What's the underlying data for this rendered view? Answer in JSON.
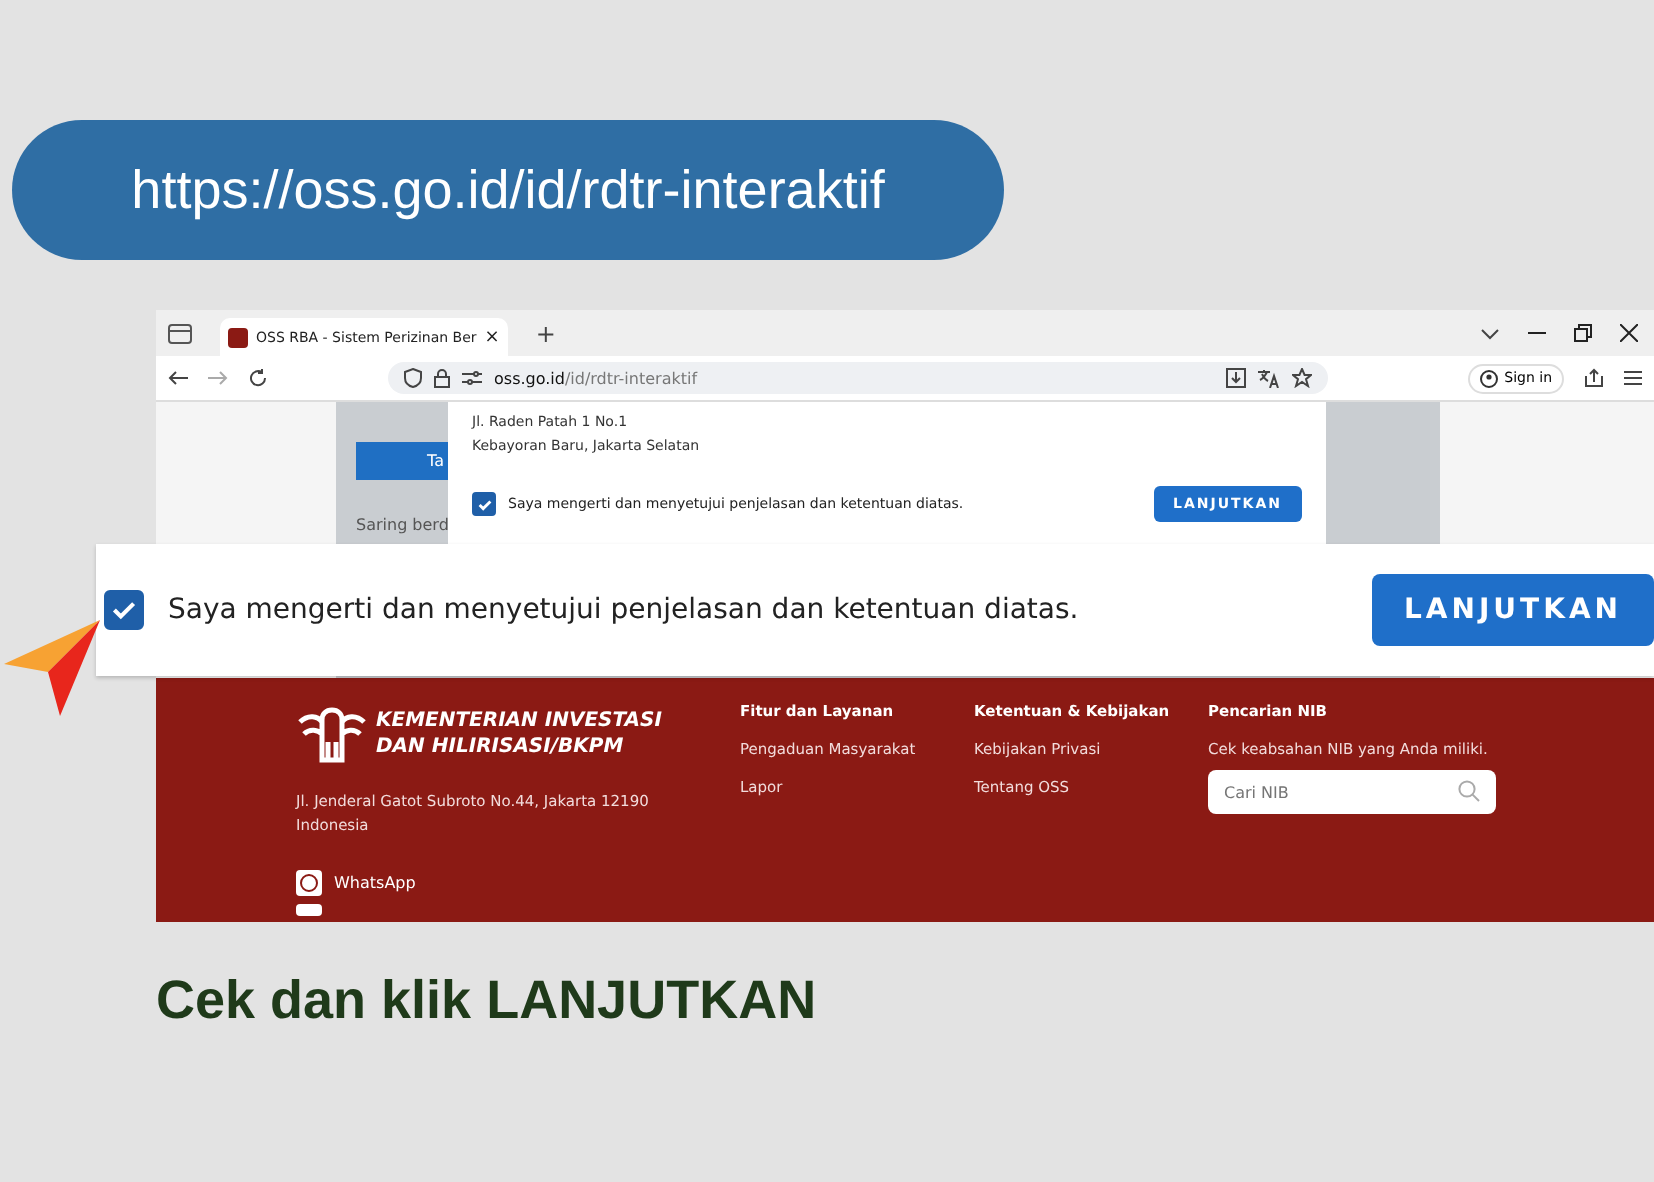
{
  "url_banner": {
    "text": "https://oss.go.id/id/rdtr-interaktif"
  },
  "browser": {
    "tab": {
      "title": "OSS RBA - Sistem Perizinan Ber",
      "close": "×"
    },
    "new_tab": "+",
    "address": {
      "host": "oss.go.id",
      "path": "/id/rdtr-interaktif"
    },
    "sign_in": "Sign in"
  },
  "page": {
    "side_button": "Ta",
    "filter_text": "Saring berd",
    "modal": {
      "address_lines": [
        "Jl. Raden Patah 1 No.1",
        "Kebayoran Baru, Jakarta Selatan"
      ],
      "agree": {
        "label": "Saya mengerti dan menyetujui penjelasan dan ketentuan diatas.",
        "checked": true
      },
      "button": "LANJUTKAN"
    }
  },
  "zoom": {
    "agree": {
      "label": "Saya mengerti dan menyetujui penjelasan dan ketentuan diatas.",
      "checked": true
    },
    "button": "LANJUTKAN"
  },
  "footer": {
    "logo_lines": [
      "KEMENTERIAN INVESTASI",
      "DAN HILIRISASI/BKPM"
    ],
    "address_lines": [
      "Jl. Jenderal Gatot Subroto No.44, Jakarta 12190",
      "Indonesia"
    ],
    "contacts": [
      "WhatsApp"
    ],
    "columns": [
      {
        "title": "Fitur dan Layanan",
        "links": [
          "Pengaduan Masyarakat",
          "Lapor"
        ]
      },
      {
        "title": "Ketentuan & Kebijakan",
        "links": [
          "Kebijakan Privasi",
          "Tentang OSS"
        ]
      }
    ],
    "nib": {
      "title": "Pencarian NIB",
      "text": "Cek keabsahan NIB yang Anda miliki.",
      "placeholder": "Cari NIB"
    }
  },
  "caption": "Cek dan klik LANJUTKAN"
}
